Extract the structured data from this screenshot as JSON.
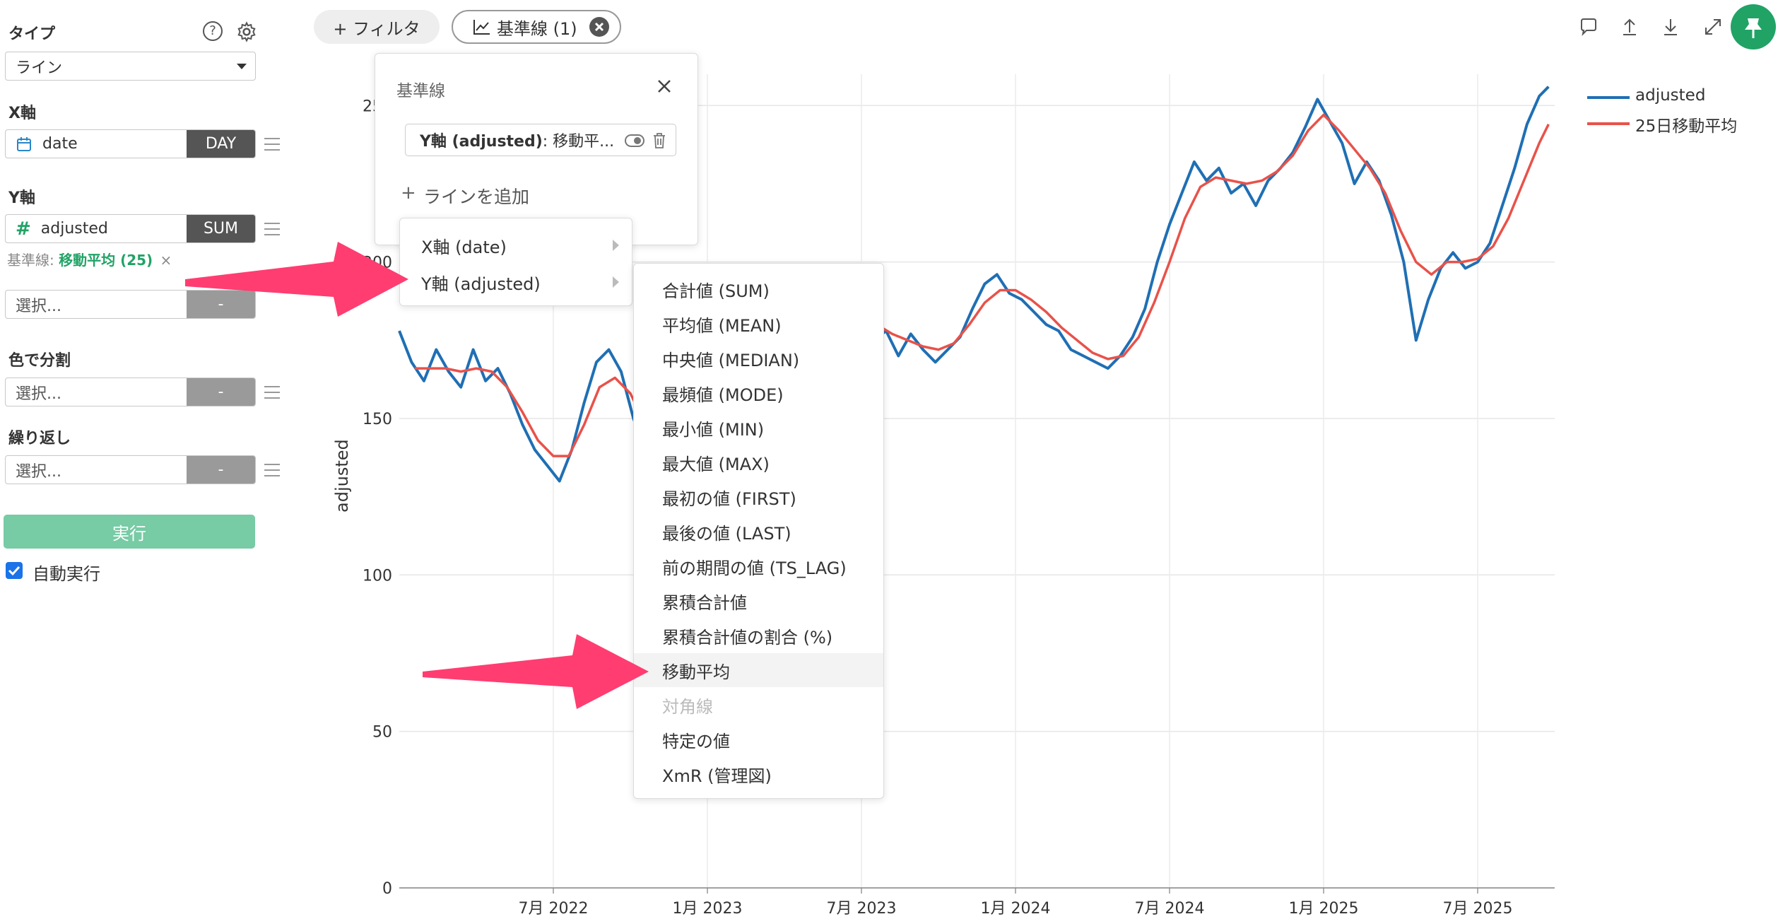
{
  "left_panel": {
    "type_label": "タイプ",
    "type_value": "ライン",
    "x_axis_label": "X軸",
    "x_field": "date",
    "x_unit": "DAY",
    "y_axis_label": "Y軸",
    "y_field": "adjusted",
    "y_agg": "SUM",
    "baseline_prefix": "基準線:",
    "baseline_value": "移動平均 (25)",
    "baseline_remove": "×",
    "select_placeholder": "選択...",
    "dash": "-",
    "color_split_label": "色で分割",
    "repeat_label": "繰り返し",
    "run_button": "実行",
    "auto_run_label": "自動実行",
    "auto_run_checked": true
  },
  "toolbar": {
    "filter_label": "+ フィルタ",
    "baseline_chip": "基準線 (1)"
  },
  "baseline_popover": {
    "title": "基準線",
    "entry_bold": "Y軸 (adjusted)",
    "entry_rest": " : 移動平...",
    "add_line": "ラインを追加",
    "add_plus": "+"
  },
  "axis_menu": {
    "items": [
      "X軸 (date)",
      "Y軸 (adjusted)"
    ]
  },
  "agg_menu": {
    "items": [
      {
        "label": "合計値 (SUM)"
      },
      {
        "label": "平均値 (MEAN)"
      },
      {
        "label": "中央値 (MEDIAN)"
      },
      {
        "label": "最頻値 (MODE)"
      },
      {
        "label": "最小値 (MIN)"
      },
      {
        "label": "最大値 (MAX)"
      },
      {
        "label": "最初の値 (FIRST)"
      },
      {
        "label": "最後の値 (LAST)"
      },
      {
        "label": "前の期間の値 (TS_LAG)"
      },
      {
        "label": "累積合計値"
      },
      {
        "label": "累積合計値の割合 (%)"
      },
      {
        "label": "移動平均",
        "active": true
      },
      {
        "label": "対角線",
        "disabled": true
      },
      {
        "label": "特定の値"
      },
      {
        "label": "XmR (管理図)"
      }
    ]
  },
  "colors": {
    "series_blue": "#1f6fb4",
    "series_red": "#e8524a",
    "accent_green": "#21a366",
    "run_button": "#77cba5",
    "arrow": "#ff3d70",
    "dark_tag": "#555555"
  },
  "chart_data": {
    "type": "line",
    "ylabel": "adjusted",
    "ylim": [
      0,
      260
    ],
    "yticks": [
      "0",
      "50",
      "100",
      "150",
      "200",
      "250"
    ],
    "xticks": [
      "7月 2022",
      "1月 2023",
      "7月 2023",
      "1月 2024",
      "7月 2024",
      "1月 2025",
      "7月 2025"
    ],
    "x_range": [
      2022.0,
      2025.75
    ],
    "legend_position": "top-right",
    "series": [
      {
        "name": "adjusted",
        "color": "#1f6fb4",
        "points": [
          [
            2022.0,
            178
          ],
          [
            2022.04,
            168
          ],
          [
            2022.08,
            162
          ],
          [
            2022.12,
            172
          ],
          [
            2022.16,
            165
          ],
          [
            2022.2,
            160
          ],
          [
            2022.24,
            172
          ],
          [
            2022.28,
            162
          ],
          [
            2022.32,
            166
          ],
          [
            2022.36,
            158
          ],
          [
            2022.4,
            148
          ],
          [
            2022.44,
            140
          ],
          [
            2022.48,
            135
          ],
          [
            2022.52,
            130
          ],
          [
            2022.56,
            140
          ],
          [
            2022.6,
            155
          ],
          [
            2022.64,
            168
          ],
          [
            2022.68,
            172
          ],
          [
            2022.72,
            165
          ],
          [
            2022.76,
            150
          ],
          [
            2022.8,
            140
          ],
          [
            2022.85,
            138
          ],
          [
            2022.9,
            142
          ],
          [
            2022.95,
            146
          ],
          [
            2023.0,
            150
          ],
          [
            2023.05,
            152
          ],
          [
            2023.1,
            155
          ],
          [
            2023.15,
            160
          ],
          [
            2023.2,
            165
          ],
          [
            2023.25,
            168
          ],
          [
            2023.3,
            172
          ],
          [
            2023.35,
            178
          ],
          [
            2023.4,
            180
          ],
          [
            2023.45,
            183
          ],
          [
            2023.5,
            185
          ],
          [
            2023.54,
            175
          ],
          [
            2023.58,
            178
          ],
          [
            2023.62,
            170
          ],
          [
            2023.66,
            177
          ],
          [
            2023.7,
            172
          ],
          [
            2023.74,
            168
          ],
          [
            2023.78,
            172
          ],
          [
            2023.82,
            176
          ],
          [
            2023.86,
            185
          ],
          [
            2023.9,
            193
          ],
          [
            2023.94,
            196
          ],
          [
            2023.98,
            190
          ],
          [
            2024.02,
            188
          ],
          [
            2024.06,
            184
          ],
          [
            2024.1,
            180
          ],
          [
            2024.14,
            178
          ],
          [
            2024.18,
            172
          ],
          [
            2024.22,
            170
          ],
          [
            2024.26,
            168
          ],
          [
            2024.3,
            166
          ],
          [
            2024.34,
            170
          ],
          [
            2024.38,
            176
          ],
          [
            2024.42,
            185
          ],
          [
            2024.46,
            200
          ],
          [
            2024.5,
            212
          ],
          [
            2024.54,
            222
          ],
          [
            2024.58,
            232
          ],
          [
            2024.62,
            226
          ],
          [
            2024.66,
            230
          ],
          [
            2024.7,
            222
          ],
          [
            2024.74,
            225
          ],
          [
            2024.78,
            218
          ],
          [
            2024.82,
            226
          ],
          [
            2024.86,
            230
          ],
          [
            2024.9,
            235
          ],
          [
            2024.94,
            243
          ],
          [
            2024.98,
            252
          ],
          [
            2025.02,
            245
          ],
          [
            2025.06,
            238
          ],
          [
            2025.1,
            225
          ],
          [
            2025.14,
            232
          ],
          [
            2025.18,
            226
          ],
          [
            2025.22,
            215
          ],
          [
            2025.26,
            200
          ],
          [
            2025.3,
            175
          ],
          [
            2025.34,
            188
          ],
          [
            2025.38,
            198
          ],
          [
            2025.42,
            203
          ],
          [
            2025.46,
            198
          ],
          [
            2025.5,
            200
          ],
          [
            2025.54,
            206
          ],
          [
            2025.58,
            218
          ],
          [
            2025.62,
            230
          ],
          [
            2025.66,
            244
          ],
          [
            2025.7,
            253
          ],
          [
            2025.73,
            256
          ]
        ]
      },
      {
        "name": "25日移動平均",
        "color": "#e8524a",
        "points": [
          [
            2022.05,
            166
          ],
          [
            2022.1,
            166
          ],
          [
            2022.15,
            166
          ],
          [
            2022.2,
            165
          ],
          [
            2022.25,
            166
          ],
          [
            2022.3,
            165
          ],
          [
            2022.35,
            160
          ],
          [
            2022.4,
            152
          ],
          [
            2022.45,
            143
          ],
          [
            2022.5,
            138
          ],
          [
            2022.55,
            138
          ],
          [
            2022.6,
            148
          ],
          [
            2022.65,
            160
          ],
          [
            2022.7,
            163
          ],
          [
            2022.75,
            158
          ],
          [
            2022.8,
            148
          ],
          [
            2022.85,
            142
          ],
          [
            2022.9,
            141
          ],
          [
            2022.95,
            144
          ],
          [
            2023.0,
            148
          ],
          [
            2023.05,
            151
          ],
          [
            2023.1,
            154
          ],
          [
            2023.15,
            158
          ],
          [
            2023.2,
            162
          ],
          [
            2023.25,
            166
          ],
          [
            2023.3,
            170
          ],
          [
            2023.35,
            174
          ],
          [
            2023.4,
            178
          ],
          [
            2023.45,
            181
          ],
          [
            2023.5,
            182
          ],
          [
            2023.55,
            180
          ],
          [
            2023.6,
            177
          ],
          [
            2023.65,
            175
          ],
          [
            2023.7,
            173
          ],
          [
            2023.75,
            172
          ],
          [
            2023.8,
            174
          ],
          [
            2023.85,
            180
          ],
          [
            2023.9,
            187
          ],
          [
            2023.95,
            191
          ],
          [
            2024.0,
            191
          ],
          [
            2024.05,
            188
          ],
          [
            2024.1,
            184
          ],
          [
            2024.15,
            179
          ],
          [
            2024.2,
            175
          ],
          [
            2024.25,
            171
          ],
          [
            2024.3,
            169
          ],
          [
            2024.35,
            170
          ],
          [
            2024.4,
            176
          ],
          [
            2024.45,
            187
          ],
          [
            2024.5,
            200
          ],
          [
            2024.55,
            214
          ],
          [
            2024.6,
            224
          ],
          [
            2024.65,
            227
          ],
          [
            2024.7,
            226
          ],
          [
            2024.75,
            225
          ],
          [
            2024.8,
            226
          ],
          [
            2024.85,
            229
          ],
          [
            2024.9,
            234
          ],
          [
            2024.95,
            242
          ],
          [
            2025.0,
            247
          ],
          [
            2025.05,
            242
          ],
          [
            2025.1,
            236
          ],
          [
            2025.15,
            230
          ],
          [
            2025.2,
            222
          ],
          [
            2025.25,
            210
          ],
          [
            2025.3,
            200
          ],
          [
            2025.35,
            196
          ],
          [
            2025.4,
            200
          ],
          [
            2025.45,
            200
          ],
          [
            2025.5,
            201
          ],
          [
            2025.55,
            205
          ],
          [
            2025.6,
            214
          ],
          [
            2025.65,
            226
          ],
          [
            2025.7,
            238
          ],
          [
            2025.73,
            244
          ]
        ]
      }
    ]
  }
}
